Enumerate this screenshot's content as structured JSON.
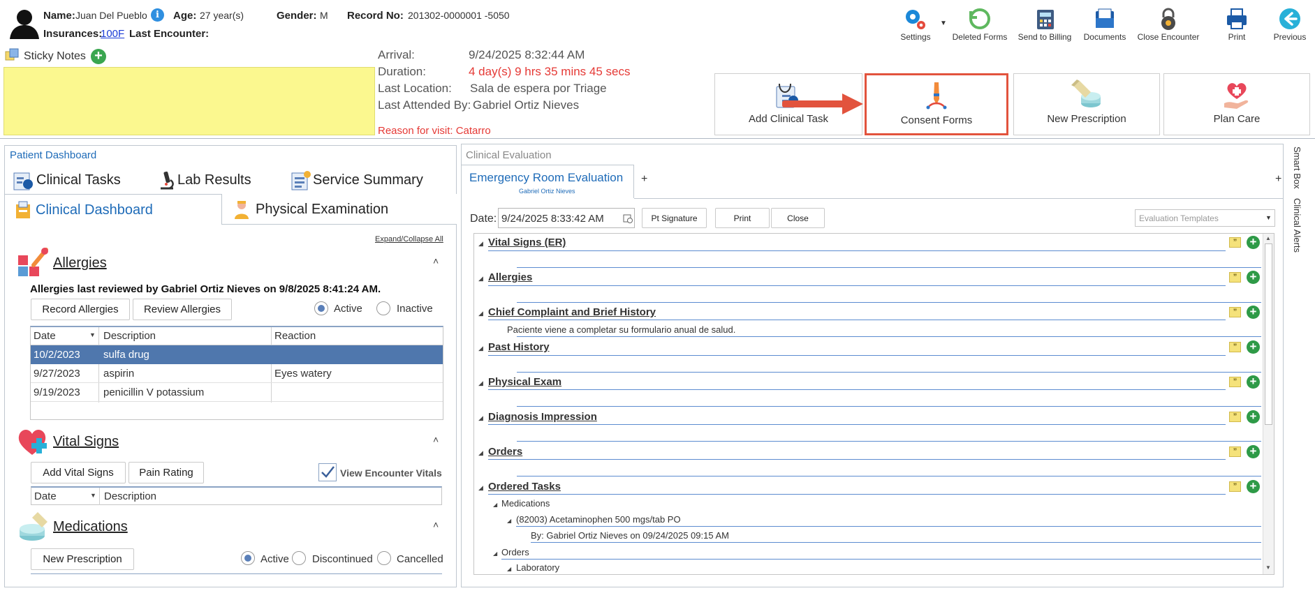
{
  "patient": {
    "name_label": "Name:",
    "name": "Juan Del Pueblo",
    "age_label": "Age:",
    "age": "27 year(s)",
    "gender_label": "Gender:",
    "gender": "M",
    "record_label": "Record No:",
    "record": "201302-0000001 -5050",
    "insurances_label": "Insurances:",
    "insurance": "100F",
    "last_encounter_label": "Last Encounter:"
  },
  "toolbar": {
    "settings": "Settings",
    "deleted_forms": "Deleted Forms",
    "send_to_billing": "Send to Billing",
    "documents": "Documents",
    "close_encounter": "Close Encounter",
    "print": "Print",
    "previous": "Previous"
  },
  "sticky_notes": {
    "label": "Sticky Notes"
  },
  "encounter": {
    "arrival_label": "Arrival:",
    "arrival": "9/24/2025 8:32:44 AM",
    "duration_label": "Duration:",
    "duration": "4 day(s) 9 hrs 35 mins 45 secs",
    "last_location_label": "Last Location:",
    "last_location": "Sala de espera por Triage",
    "last_attended_label": "Last Attended By:",
    "last_attended": "Gabriel Ortiz Nieves",
    "reason": "Reason for visit: Catarro"
  },
  "actions": {
    "add_clinical_task": "Add Clinical Task",
    "consent_forms": "Consent Forms",
    "new_prescription": "New Prescription",
    "plan_care": "Plan Care"
  },
  "dashboard": {
    "title": "Patient Dashboard",
    "tabs": {
      "clinical_tasks": "Clinical Tasks",
      "lab_results": "Lab Results",
      "service_summary": "Service Summary",
      "clinical_dashboard": "Clinical Dashboard",
      "physical_examination": "Physical Examination"
    },
    "expand_collapse": "Expand/Collapse All",
    "allergies": {
      "title": "Allergies",
      "reviewed": "Allergies last reviewed by Gabriel Ortiz Nieves on 9/8/2025 8:41:24 AM.",
      "record_btn": "Record Allergies",
      "review_btn": "Review Allergies",
      "active": "Active",
      "inactive": "Inactive",
      "columns": [
        "Date",
        "Description",
        "Reaction"
      ],
      "rows": [
        {
          "date": "10/2/2023",
          "description": "sulfa drug",
          "reaction": ""
        },
        {
          "date": "9/27/2023",
          "description": "aspirin",
          "reaction": "Eyes watery"
        },
        {
          "date": "9/19/2023",
          "description": "penicillin V potassium",
          "reaction": ""
        }
      ]
    },
    "vitals": {
      "title": "Vital Signs",
      "add_btn": "Add Vital Signs",
      "pain_btn": "Pain Rating",
      "view_encounter": "View Encounter Vitals",
      "columns": [
        "Date",
        "Description"
      ]
    },
    "medications": {
      "title": "Medications",
      "new_btn": "New Prescription",
      "active": "Active",
      "discontinued": "Discontinued",
      "cancelled": "Cancelled"
    }
  },
  "evaluation": {
    "panel_title": "Clinical Evaluation",
    "tab_title": "Emergency Room Evaluation",
    "tab_sub": "Gabriel Ortiz Nieves",
    "add_tab": "+",
    "date_label": "Date:",
    "date_value": "9/24/2025 8:33:42 AM",
    "pt_signature": "Pt Signature",
    "print": "Print",
    "close": "Close",
    "templates_placeholder": "Evaluation Templates",
    "sections": [
      "Vital Signs (ER)",
      "Allergies",
      "Chief Complaint and Brief History",
      "Past History",
      "Physical Exam",
      "Diagnosis Impression",
      "Orders",
      "Ordered Tasks"
    ],
    "chief_complaint_text": "Paciente viene a completar su formulario anual de salud.",
    "ordered": {
      "medications": "Medications",
      "med_item": "(82003) Acetaminophen 500 mgs/tab PO",
      "med_by": "By: Gabriel Ortiz Nieves on 09/24/2025 09:15 AM",
      "orders": "Orders",
      "laboratory": "Laboratory"
    }
  },
  "side_tabs": {
    "smart_box": "Smart Box",
    "clinical_alerts": "Clinical Alerts"
  },
  "colors": {
    "accent": "#1e6bb8",
    "highlight_row": "#4f77ad",
    "sticky": "#fbf88f",
    "red": "#e53935",
    "callout": "#e2533d"
  }
}
